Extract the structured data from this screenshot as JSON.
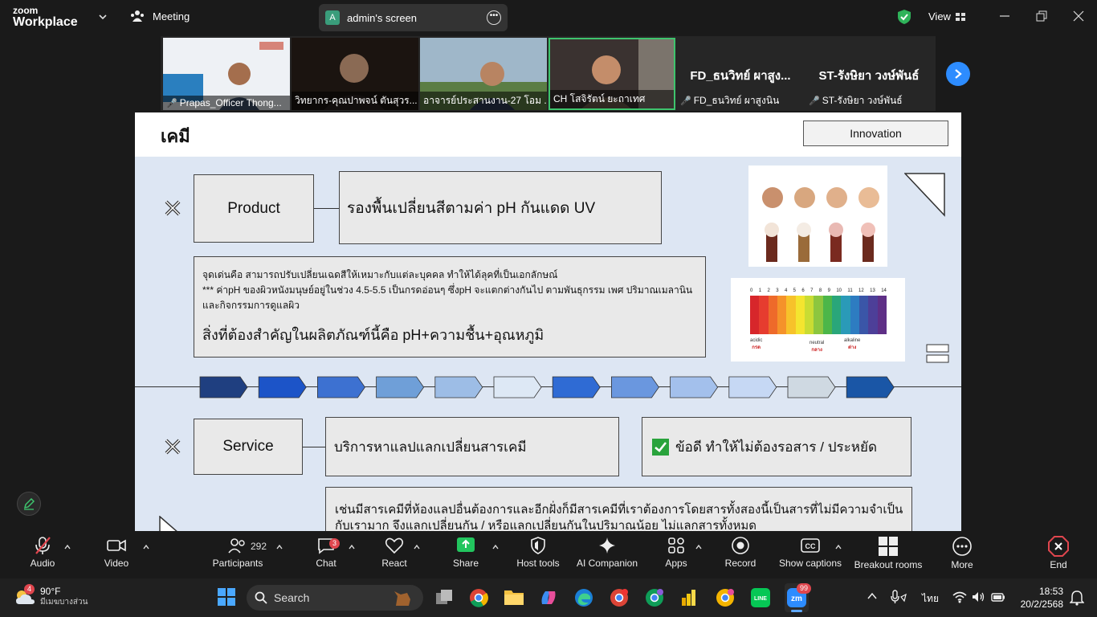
{
  "app": {
    "brand_line1": "zoom",
    "brand_line2": "Workplace",
    "meeting_label": "Meeting",
    "share_initial": "A",
    "share_label": "admin's screen",
    "view_label": "View"
  },
  "participants_strip": [
    {
      "name": "Prapas_Officer Thong..."
    },
    {
      "name": "วิทยากร-คุณปาพจน์ ตันสุวร..."
    },
    {
      "name": "อาจารย์ประสานงาน-27 โอม ..."
    },
    {
      "name": "CH โสจิรัตน์ ยะถาเทศ"
    },
    {
      "name": "FD_ธนวิทย์ ผาสูงนิน",
      "display": "FD_ธนวิทย์ ผาสูง..."
    },
    {
      "name": "ST-รังษิยา วงษ์พันธ์",
      "display": "ST-รังษิยา วงษ์พันธ์"
    }
  ],
  "slide": {
    "title": "เคมี",
    "innovation": "Innovation",
    "product_label": "Product",
    "product_desc": "รองพื้นเปลี่ยนสีตามค่า pH กันแดด UV",
    "detail_line1": "จุดเด่นคือ สามารถปรับเปลี่ยนเฉดสีให้เหมาะกับแต่ละบุคคล ทำให้ได้ลุคที่เป็นเอกลักษณ์",
    "detail_line2": "*** ค่าpH ของผิวหนังมนุษย์อยู่ในช่วง 4.5-5.5 เป็นกรดอ่อนๆ ซึ่งpH จะแตกต่างกันไป ตามพันธุกรรม เพศ ปริมาณเมลานิน และกิจกรรมการดูแลผิว",
    "detail_important": "สิ่งที่ต้องสำคัญในผลิตภัณฑ์นี้คือ pH+ความชื้น+อุณหภูมิ",
    "ph_numbers": [
      "0",
      "1",
      "2",
      "3",
      "4",
      "5",
      "6",
      "7",
      "8",
      "9",
      "10",
      "11",
      "12",
      "13",
      "14"
    ],
    "ph_acidic": "acidic",
    "ph_acidic_th": "กรด",
    "ph_neutral": "neutral",
    "ph_neutral_th": "กลาง",
    "ph_alkaline": "alkaline",
    "ph_alkaline_th": "ด่าง",
    "service_label": "Service",
    "service_desc": "บริการหาแลปแลกเปลี่ยนสารเคมี",
    "service_advantage": "ข้อดี ทำให้ไม่ต้องรอสาร / ประหยัด",
    "service_detail": "เช่นมีสารเคมีที่ห้องแลปอื่นต้องการและอีกฝั่งก็มีสารเคมีที่เราต้องการโดยสารทั้งสองนี้เป็นสารที่ไม่มีความจำเป็นกับเรามาก จึงแลกเปลี่ยนกัน / หรือแลกเปลี่ยนกันในปริมาณน้อย ไม่แลกสารทั้งหมด",
    "arrow_colors": [
      "#1f3f80",
      "#1c54c8",
      "#3d71d1",
      "#6f9fd8",
      "#9dbde6",
      "#dde8f5",
      "#2f6bd4",
      "#6a97df",
      "#a3c0ec",
      "#c6d8f4",
      "#cfd9e2",
      "#1a56a6"
    ]
  },
  "controls": {
    "audio": "Audio",
    "video": "Video",
    "participants": "Participants",
    "participants_count": "292",
    "chat": "Chat",
    "chat_badge": "3",
    "react": "React",
    "share": "Share",
    "host_tools": "Host tools",
    "ai_companion": "AI Companion",
    "apps": "Apps",
    "record": "Record",
    "captions": "Show captions",
    "breakout": "Breakout rooms",
    "more": "More",
    "end": "End"
  },
  "taskbar": {
    "weather_temp": "90°F",
    "weather_desc": "มีเมฆบางส่วน",
    "weather_badge": "4",
    "search": "Search",
    "zoom_badge": "99",
    "lang": "ไทย",
    "time": "18:53",
    "date": "20/2/2568"
  }
}
